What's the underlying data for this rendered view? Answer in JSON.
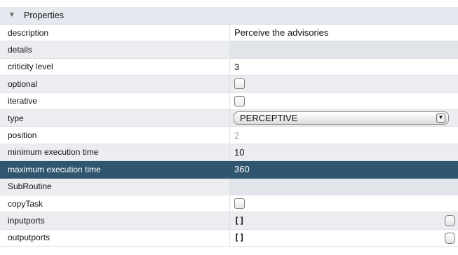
{
  "header": {
    "title": "Properties",
    "collapse_icon": "triangle-down-icon"
  },
  "rows": [
    {
      "name": "description",
      "value": "Perceive the advisories"
    },
    {
      "name": "details",
      "value": ""
    },
    {
      "name": "criticity level",
      "value": "3"
    },
    {
      "name": "optional",
      "checked": false
    },
    {
      "name": "iterative",
      "checked": false
    },
    {
      "name": "type",
      "value": "PERCEPTIVE"
    },
    {
      "name": "position",
      "value": "2"
    },
    {
      "name": "minimum execution time",
      "value": "10"
    },
    {
      "name": "maximum execution time",
      "value": "360",
      "selected": true
    },
    {
      "name": "SubRoutine",
      "value": ""
    },
    {
      "name": "copyTask",
      "checked": false
    },
    {
      "name": "inputports",
      "value": "[]"
    },
    {
      "name": "outputports",
      "value": "[]"
    }
  ],
  "colors": {
    "selected_row": "#30566f",
    "header_bg": "#e5e8ee",
    "alt_row": "#ebedf0"
  }
}
